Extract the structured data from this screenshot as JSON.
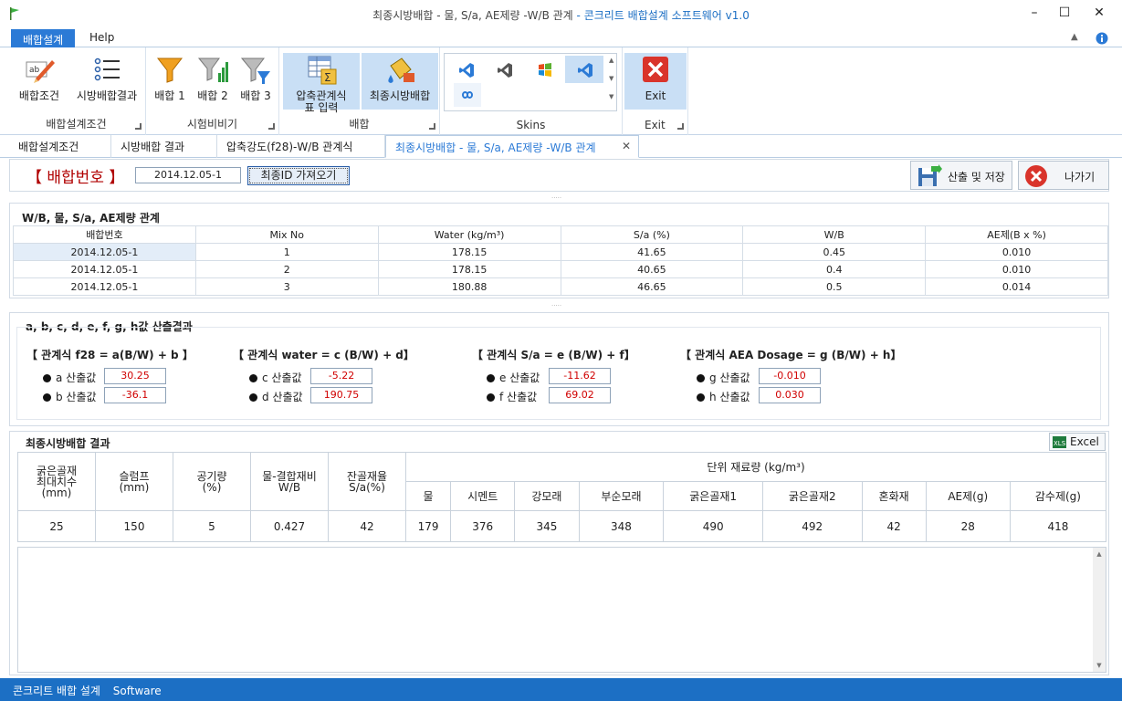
{
  "window": {
    "title_part1": "최종시방배합 - 물, S/a, AE제량 -W/B 관계",
    "title_part2": "- 콘크리트 배합설계 소프트웨어 v1.0",
    "minimize": "–",
    "maximize": "☐",
    "close": "✕"
  },
  "ribbon": {
    "tabs": [
      "배합설계",
      "Help"
    ],
    "groups": {
      "mix_design": {
        "label": "배합설계조건",
        "buttons": [
          "배합조건",
          "시방배합결과"
        ]
      },
      "test_mix": {
        "label": "시험비비기",
        "buttons": [
          "배합 1",
          "배합 2",
          "배합 3"
        ]
      },
      "mix": {
        "label": "배합",
        "buttons": [
          "압축관계식표 입력",
          "최종시방배합"
        ]
      },
      "skins": {
        "label": "Skins"
      },
      "exit": {
        "label": "Exit",
        "button": "Exit"
      }
    }
  },
  "doc_tabs": [
    "배합설계조건",
    "시방배합 결과",
    "압축강도(f28)-W/B 관계식",
    "최종시방배합 - 물, S/a, AE제량 -W/B 관계"
  ],
  "header": {
    "mix_no_label": "【 배합번호 】",
    "mix_no_value": "2014.12.05-1",
    "fetch_button": "최종ID 가져오기",
    "calc_save_button": "산출 및 저장",
    "exit_button": "나가기"
  },
  "relation_table": {
    "title": "W/B, 물, S/a, AE제량 관계",
    "columns": [
      "배합번호",
      "Mix No",
      "Water (kg/m³)",
      "S/a (%)",
      "W/B",
      "AE제(B x %)"
    ],
    "rows": [
      [
        "2014.12.05-1",
        "1",
        "178.15",
        "41.65",
        "0.45",
        "0.010"
      ],
      [
        "2014.12.05-1",
        "2",
        "178.15",
        "40.65",
        "0.4",
        "0.010"
      ],
      [
        "2014.12.05-1",
        "3",
        "180.88",
        "46.65",
        "0.5",
        "0.014"
      ]
    ]
  },
  "coef": {
    "title": "a, b, c, d, e, f, g, h값 산출결과",
    "eq1": {
      "title": "【 관계식 f28 = a(B/W) + b 】",
      "l1": "a 산출값",
      "v1": "30.25",
      "l2": "b 산출값",
      "v2": "-36.1"
    },
    "eq2": {
      "title": "【 관계식 water = c (B/W) + d】",
      "l1": "c 산출값",
      "v1": "-5.22",
      "l2": "d 산출값",
      "v2": "190.75"
    },
    "eq3": {
      "title": "【 관계식 S/a = e (B/W) + f】",
      "l1": "e 산출값",
      "v1": "-11.62",
      "l2": "f 산출값",
      "v2": "69.02"
    },
    "eq4": {
      "title": "【 관계식 AEA Dosage = g (B/W) + h】",
      "l1": "g 산출값",
      "v1": "-0.010",
      "l2": "h 산출값",
      "v2": "0.030"
    }
  },
  "result": {
    "title": "최종시방배합 결과",
    "excel_button": "Excel",
    "left_headers": [
      "굵은골재\n최대치수\n(mm)",
      "슬럼프\n(mm)",
      "공기량\n(%)",
      "물-결합재비\nW/B",
      "잔골재율\nS/a(%)"
    ],
    "unit_header": "단위 재료량 (kg/m³)",
    "unit_columns": [
      "물",
      "시멘트",
      "강모래",
      "부순모래",
      "굵은골재1",
      "굵은골재2",
      "혼화재",
      "AE제(g)",
      "감수제(g)"
    ],
    "values": [
      "25",
      "150",
      "5",
      "0.427",
      "42",
      "179",
      "376",
      "345",
      "348",
      "490",
      "492",
      "42",
      "28",
      "418"
    ]
  },
  "status": {
    "app": "콘크리트 배합 설계",
    "sub": "Software"
  },
  "colors": {
    "accent": "#2b7ad6",
    "status": "#1c6fc4",
    "red": "#d00000"
  }
}
